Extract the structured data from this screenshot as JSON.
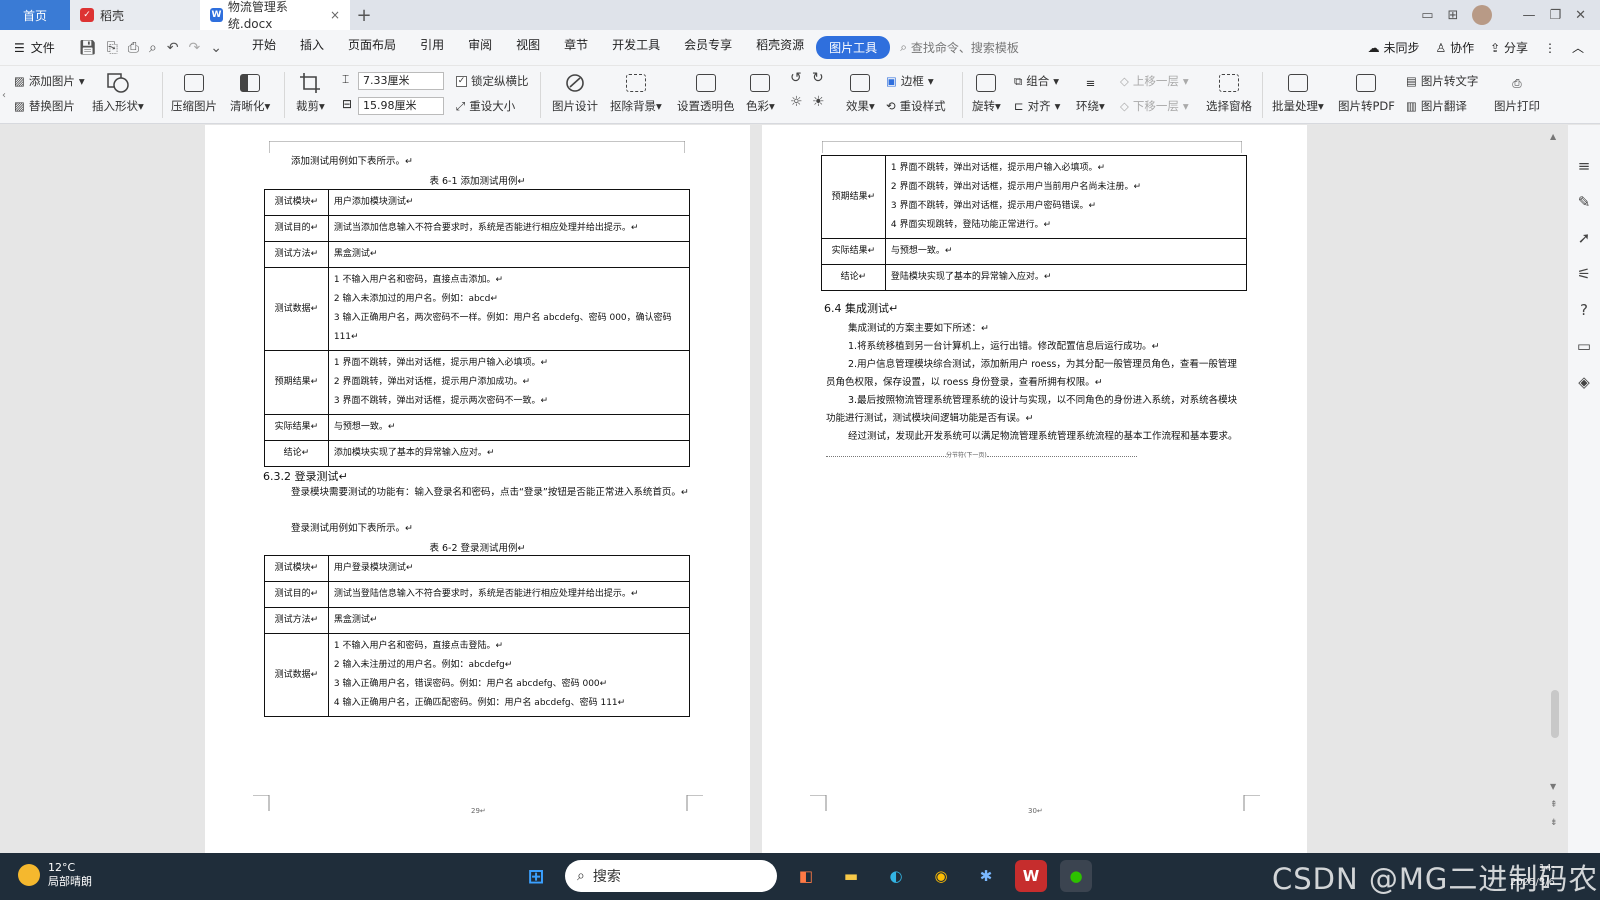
{
  "tabs": {
    "home": "首页",
    "daoke": "稻壳",
    "doc_title": "物流管理系统.docx",
    "add": "+"
  },
  "menu": {
    "file": "文件",
    "items": [
      "开始",
      "插入",
      "页面布局",
      "引用",
      "审阅",
      "视图",
      "章节",
      "开发工具",
      "会员专享",
      "稻壳资源",
      "图片工具"
    ],
    "search_placeholder": "查找命令、搜索模板",
    "sync": "未同步",
    "collab": "协作",
    "share": "分享"
  },
  "ribbon": {
    "add_image": "添加图片",
    "replace_image": "替换图片",
    "insert_shape": "插入形状",
    "compress": "压缩图片",
    "sharpen": "清晰化",
    "crop": "裁剪",
    "width_value": "7.33厘米",
    "height_value": "15.98厘米",
    "lock_ratio": "锁定纵横比",
    "reset_size": "重设大小",
    "image_design": "图片设计",
    "remove_bg": "抠除背景",
    "transparent": "设置透明色",
    "color": "色彩",
    "effects": "效果",
    "border": "边框",
    "reset_style": "重设样式",
    "rotate": "旋转",
    "group": "组合",
    "align": "对齐",
    "wrap": "环绕",
    "up_layer": "上移一层",
    "down_layer": "下移一层",
    "select_pane": "选择窗格",
    "batch": "批量处理",
    "to_pdf": "图片转PDF",
    "to_text": "图片转文字",
    "translate": "图片翻译",
    "print": "图片打印"
  },
  "page1": {
    "intro": "添加测试用例如下表所示。↵",
    "table1_caption": "表 6-1 添加测试用例↵",
    "table1": [
      {
        "label": "测试模块↵",
        "value": [
          "用户添加模块测试↵"
        ]
      },
      {
        "label": "测试目的↵",
        "value": [
          "测试当添加信息输入不符合要求时，系统是否能进行相应处理并给出提示。↵"
        ]
      },
      {
        "label": "测试方法↵",
        "value": [
          "黑盒测试↵"
        ]
      },
      {
        "label": "测试数据↵",
        "value": [
          "1 不输入用户名和密码，直接点击添加。↵",
          "2 输入未添加过的用户名。例如：abcd↵",
          "3 输入正确用户名，两次密码不一样。例如：用户名 abcdefg、密码 000，确认密码 111↵"
        ]
      },
      {
        "label": "预期结果↵",
        "value": [
          "1 界面不跳转，弹出对话框，提示用户输入必填项。↵",
          "2 界面跳转，弹出对话框，提示用户添加成功。↵",
          "3 界面不跳转，弹出对话框，提示两次密码不一致。↵"
        ]
      },
      {
        "label": "实际结果↵",
        "value": [
          "与预想一致。↵"
        ]
      },
      {
        "label": "结论↵",
        "value": [
          "添加模块实现了基本的异常输入应对。↵"
        ]
      }
    ],
    "heading_632": "6.3.2 登录测试↵",
    "login_para": "登录模块需要测试的功能有：输入登录名和密码，点击“登录”按钮是否能正常进入系统首页。↵",
    "login_intro": "登录测试用例如下表所示。↵",
    "table2_caption": "表 6-2 登录测试用例↵",
    "table2": [
      {
        "label": "测试模块↵",
        "value": [
          "用户登录模块测试↵"
        ]
      },
      {
        "label": "测试目的↵",
        "value": [
          "测试当登陆信息输入不符合要求时，系统是否能进行相应处理并给出提示。↵"
        ]
      },
      {
        "label": "测试方法↵",
        "value": [
          "黑盒测试↵"
        ]
      },
      {
        "label": "测试数据↵",
        "value": [
          "1 不输入用户名和密码，直接点击登陆。↵",
          "2 输入未注册过的用户名。例如：abcdefg↵",
          "3 输入正确用户名，错误密码。例如：用户名 abcdefg、密码 000↵",
          "4 输入正确用户名，正确匹配密码。例如：用户名 abcdefg、密码 111↵"
        ]
      }
    ],
    "page_number": "29↵"
  },
  "page2": {
    "table3": [
      {
        "label": "预期结果↵",
        "value": [
          "1 界面不跳转，弹出对话框，提示用户输入必填项。↵",
          "2 界面不跳转，弹出对话框，提示用户当前用户名尚未注册。↵",
          "3 界面不跳转，弹出对话框，提示用户密码错误。↵",
          "4 界面实现跳转，登陆功能正常进行。↵"
        ]
      },
      {
        "label": "实际结果↵",
        "value": [
          "与预想一致。↵"
        ]
      },
      {
        "label": "结论↵",
        "value": [
          "登陆模块实现了基本的异常输入应对。↵"
        ]
      }
    ],
    "heading_64": "6.4 集成测试↵",
    "paras": [
      "集成测试的方案主要如下所述：↵",
      "1.将系统移植到另一台计算机上，运行出错。修改配置信息后运行成功。↵",
      "2.用户信息管理模块综合测试，添加新用户 roess，为其分配一般管理员角色，查看一般管理员角色权限，保存设置，以 roess 身份登录，查看所拥有权限。↵",
      "3.最后按照物流管理系统管理系统的设计与实现，以不同角色的身份进入系统，对系统各模块功能进行测试，测试模块间逻辑功能是否有误。↵",
      "经过测试，发现此开发系统可以满足物流管理系统管理系统流程的基本工作流程和基本要求。"
    ],
    "section_break": "分节符(下一页)",
    "page_number": "30↵"
  },
  "taskbar": {
    "temp": "12°C",
    "weather": "局部晴朗",
    "search": "搜索",
    "time": "14:",
    "date": "2025/3/6"
  },
  "watermark": "CSDN @MG二进制码农",
  "colors": {
    "accent": "#2f6fdd",
    "home_tab": "#3a7bd5",
    "taskbar": "#1f2d3a"
  }
}
